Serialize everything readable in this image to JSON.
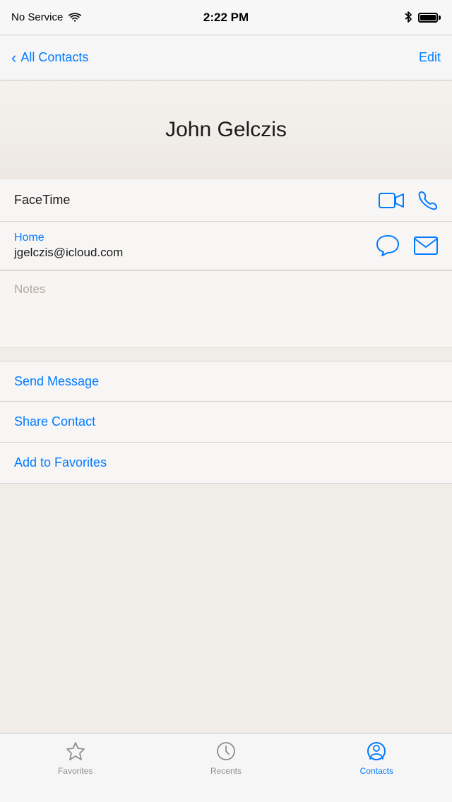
{
  "statusBar": {
    "carrier": "No Service",
    "time": "2:22 PM",
    "wifi": true,
    "bluetooth": true,
    "battery": 100
  },
  "navBar": {
    "backLabel": "All Contacts",
    "editLabel": "Edit"
  },
  "contact": {
    "name": "John Gelczis",
    "email_label": "Home",
    "email": "jgelczis@icloud.com",
    "facetime_label": "FaceTime",
    "notes_placeholder": "Notes"
  },
  "actions": {
    "sendMessage": "Send Message",
    "shareContact": "Share Contact",
    "addToFavorites": "Add to Favorites"
  },
  "tabBar": {
    "favorites": "Favorites",
    "recents": "Recents",
    "contacts": "Contacts",
    "activeTab": "contacts"
  }
}
